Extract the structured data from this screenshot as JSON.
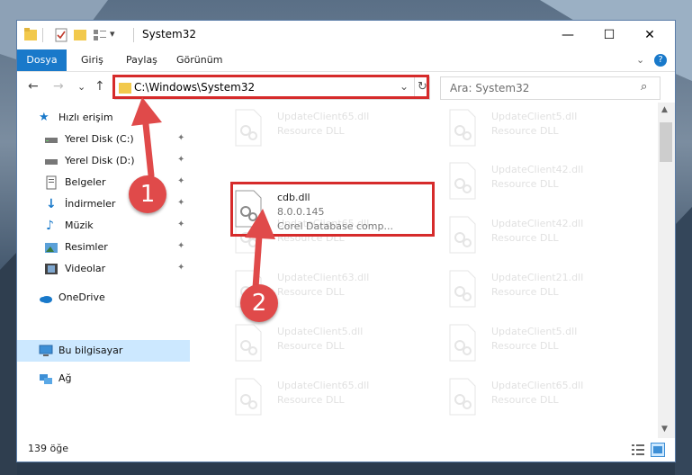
{
  "window": {
    "title": "System32",
    "min_glyph": "—",
    "max_glyph": "☐",
    "close_glyph": "✕"
  },
  "ribbon": {
    "tabs": [
      "Dosya",
      "Giriş",
      "Paylaş",
      "Görünüm"
    ],
    "collapse_glyph": "⌄",
    "help_glyph": "?"
  },
  "nav": {
    "back_glyph": "←",
    "forward_glyph": "→",
    "recent_glyph": "⌄",
    "up_glyph": "↑",
    "address": "C:\\Windows\\System32",
    "address_dropdown_glyph": "⌄",
    "refresh_glyph": "↻",
    "search_placeholder": "Ara: System32",
    "search_glyph": "⌕"
  },
  "sidebar": {
    "items": [
      {
        "label": "Hızlı erişim",
        "icon": "star-icon"
      },
      {
        "label": "Yerel Disk (C:)",
        "icon": "drive-icon",
        "pinned": true
      },
      {
        "label": "Yerel Disk (D:)",
        "icon": "drive-icon",
        "pinned": true
      },
      {
        "label": "Belgeler",
        "icon": "documents-icon",
        "pinned": true
      },
      {
        "label": "İndirmeler",
        "icon": "download-icon",
        "pinned": true
      },
      {
        "label": "Müzik",
        "icon": "music-icon",
        "pinned": true
      },
      {
        "label": "Resimler",
        "icon": "pictures-icon",
        "pinned": true
      },
      {
        "label": "Videolar",
        "icon": "videos-icon",
        "pinned": true
      },
      {
        "label": "OneDrive",
        "icon": "cloud-icon"
      },
      {
        "label": "Bu bilgisayar",
        "icon": "computer-icon",
        "selected": true
      },
      {
        "label": "Ağ",
        "icon": "network-icon"
      }
    ],
    "pin_glyph": "📌"
  },
  "files": {
    "highlighted": {
      "name": "cdb.dll",
      "version": "8.0.0.145",
      "description": "Corel Database comp..."
    },
    "faded": [
      {
        "name": "UpdateClient65.dll",
        "desc": "Resource DLL"
      },
      {
        "name": "UpdateClient5.dll",
        "desc": "Resource DLL"
      },
      {
        "name": "UpdateClient42.dll",
        "desc": "Resource DLL"
      },
      {
        "name": "UpdateClient65.dll",
        "desc": "Resource DLL"
      },
      {
        "name": "UpdateClient42.dll",
        "desc": "Resource DLL"
      },
      {
        "name": "UpdateClient63.dll",
        "desc": "Resource DLL"
      },
      {
        "name": "UpdateClient21.dll",
        "desc": "Resource DLL"
      },
      {
        "name": "UpdateClient5.dll",
        "desc": "Resource DLL"
      },
      {
        "name": "UpdateClient5.dll",
        "desc": "Resource DLL"
      },
      {
        "name": "UpdateClient65.dll",
        "desc": "Resource DLL"
      },
      {
        "name": "UpdateClient65.dll",
        "desc": "Resource DLL"
      }
    ]
  },
  "status": {
    "count": "139 öğe"
  },
  "callouts": {
    "one": "1",
    "two": "2"
  },
  "colors": {
    "accent": "#1979ca",
    "highlight": "#d62b2b",
    "selected": "#cce8ff"
  }
}
